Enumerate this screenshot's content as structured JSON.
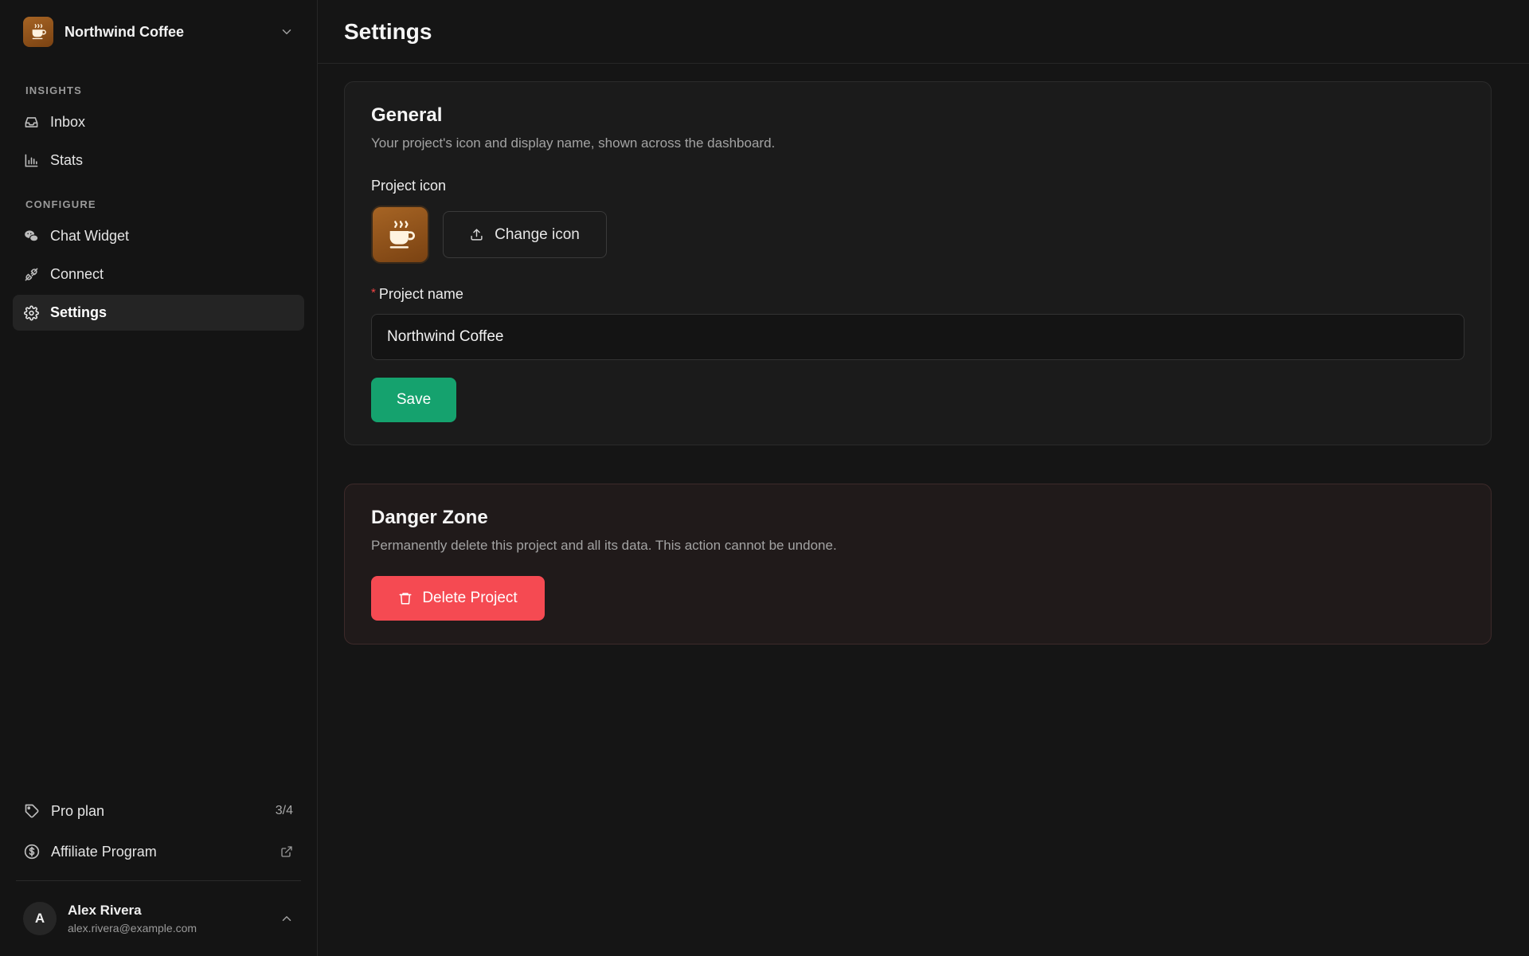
{
  "project": {
    "name": "Northwind Coffee"
  },
  "sidebar": {
    "sections": [
      {
        "label": "INSIGHTS"
      },
      {
        "label": "CONFIGURE"
      }
    ],
    "items": [
      {
        "label": "Inbox",
        "icon": "inbox-icon"
      },
      {
        "label": "Stats",
        "icon": "bar-chart-icon"
      },
      {
        "label": "Chat Widget",
        "icon": "chat-bubbles-icon"
      },
      {
        "label": "Connect",
        "icon": "plug-icon"
      },
      {
        "label": "Settings",
        "icon": "gear-icon",
        "active": true
      }
    ],
    "plan": {
      "label": "Pro plan",
      "count": "3/4"
    },
    "affiliate": {
      "label": "Affiliate Program"
    }
  },
  "user": {
    "name": "Alex Rivera",
    "email": "alex.rivera@example.com",
    "initial": "A"
  },
  "page": {
    "title": "Settings"
  },
  "general": {
    "title": "General",
    "description": "Your project's icon and display name, shown across the dashboard.",
    "icon_label": "Project icon",
    "change_icon_label": "Change icon",
    "name_label": "Project name",
    "required_mark": "*",
    "name_value": "Northwind Coffee",
    "save_label": "Save"
  },
  "danger": {
    "title": "Danger Zone",
    "description": "Permanently delete this project and all its data. This action cannot be undone.",
    "delete_label": "Delete Project"
  },
  "colors": {
    "accent_green": "#15a26e",
    "danger_red": "#f54a52",
    "project_brown": "#8f5219"
  }
}
